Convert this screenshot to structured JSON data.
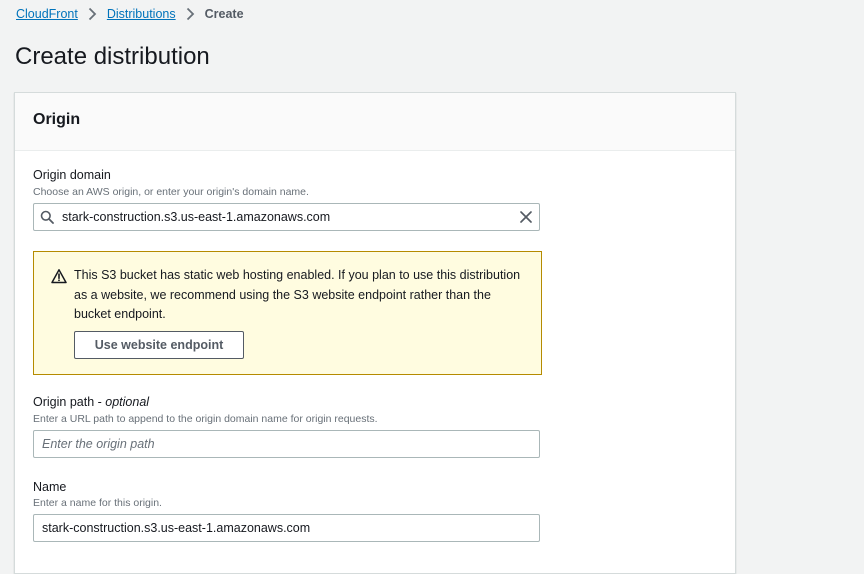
{
  "breadcrumb": {
    "items": [
      {
        "label": "CloudFront"
      },
      {
        "label": "Distributions"
      }
    ],
    "current": "Create"
  },
  "page": {
    "title": "Create distribution"
  },
  "origin_panel": {
    "title": "Origin",
    "origin_domain": {
      "label": "Origin domain",
      "hint": "Choose an AWS origin, or enter your origin's domain name.",
      "value": "stark-construction.s3.us-east-1.amazonaws.com"
    },
    "warning": {
      "message": "This S3 bucket has static web hosting enabled. If you plan to use this distribution as a website, we recommend using the S3 website endpoint rather than the bucket endpoint.",
      "button_label": "Use website endpoint"
    },
    "origin_path": {
      "label": "Origin path -",
      "label_optional": "optional",
      "hint": "Enter a URL path to append to the origin domain name for origin requests.",
      "value": "",
      "placeholder": "Enter the origin path"
    },
    "name": {
      "label": "Name",
      "hint": "Enter a name for this origin.",
      "value": "stark-construction.s3.us-east-1.amazonaws.com"
    }
  },
  "colors": {
    "link": "#0073bb",
    "page_background": "#f2f3f3",
    "warning_background": "#fffce0",
    "warning_border": "#b58b00",
    "input_border": "#aab7b8"
  },
  "icons": {
    "breadcrumb_separator": "chevron-right-icon",
    "search": "search-icon",
    "clear": "close-icon",
    "warning": "warning-icon"
  }
}
